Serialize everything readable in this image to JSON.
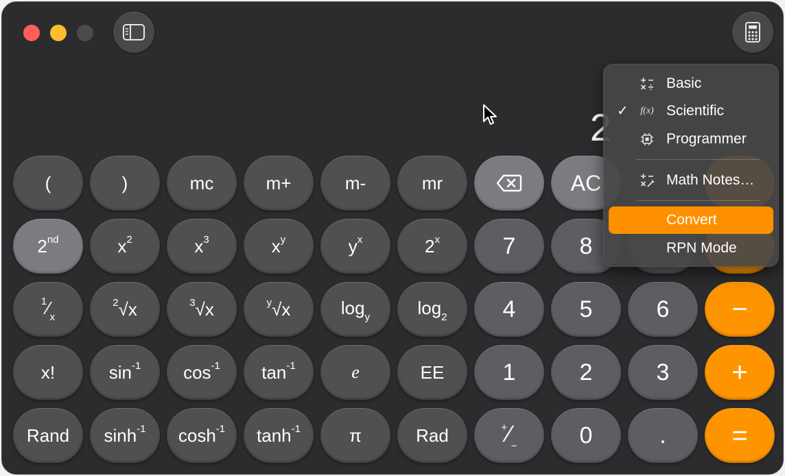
{
  "window": {
    "app": "Calculator"
  },
  "display": {
    "value": "2"
  },
  "toolbar": {
    "sidebar_icon": "sidebar-icon",
    "mode_icon": "calculator-icon"
  },
  "keys": {
    "r1": [
      "(",
      ")",
      "mc",
      "m+",
      "m-",
      "mr",
      "",
      "AC"
    ],
    "r2": [
      "2nd",
      "x2",
      "x3",
      "xy",
      "yx",
      "2x",
      "7",
      "8"
    ],
    "r3": [
      "1/x",
      "2√x",
      "3√x",
      "y√x",
      "logy",
      "log2",
      "4",
      "5",
      "6",
      "−"
    ],
    "r4": [
      "x!",
      "sin-1",
      "cos-1",
      "tan-1",
      "e",
      "EE",
      "1",
      "2",
      "3",
      "+"
    ],
    "r5": [
      "Rand",
      "sinh-1",
      "cosh-1",
      "tanh-1",
      "π",
      "Rad",
      "+/−",
      "0",
      ".",
      "="
    ]
  },
  "labels": {
    "open_paren": "(",
    "close_paren": ")",
    "mc": "mc",
    "mplus": "m+",
    "mminus": "m-",
    "mr": "mr",
    "ac": "AC",
    "second_base": "2",
    "second_sup": "nd",
    "x": "x",
    "y": "y",
    "e_sup": "x",
    "two": "2",
    "three": "3",
    "seven": "7",
    "eight": "8",
    "four": "4",
    "five": "5",
    "six": "6",
    "one": "1",
    "two_num": "2",
    "three_num": "3",
    "zero": "0",
    "dot": ".",
    "minus": "−",
    "plus": "+",
    "equals": "=",
    "xfact": "x!",
    "sin": "sin",
    "cos": "cos",
    "tan": "tan",
    "inv": "-1",
    "e_const": "e",
    "ee": "EE",
    "rand": "Rand",
    "sinh": "sinh",
    "cosh": "cosh",
    "tanh": "tanh",
    "pi": "π",
    "rad": "Rad",
    "log": "log",
    "log_y": "y",
    "log_2": "2",
    "sqrt": "√",
    "one_num": "1"
  },
  "menu": {
    "items": [
      {
        "label": "Basic",
        "icon": "basic-ops-icon",
        "checked": false
      },
      {
        "label": "Scientific",
        "icon": "function-icon",
        "icon_text": "f(x)",
        "checked": true,
        "check": "✓"
      },
      {
        "label": "Programmer",
        "icon": "chip-icon",
        "checked": false
      },
      {
        "label": "Math Notes…",
        "icon": "math-notes-icon",
        "checked": false
      },
      {
        "label": "Convert",
        "highlighted": true
      },
      {
        "label": "RPN Mode"
      }
    ]
  },
  "colors": {
    "orange": "#fe9500",
    "window_bg": "#2c2c2e",
    "function_key": "#505053",
    "number_key": "#5e5e62"
  }
}
